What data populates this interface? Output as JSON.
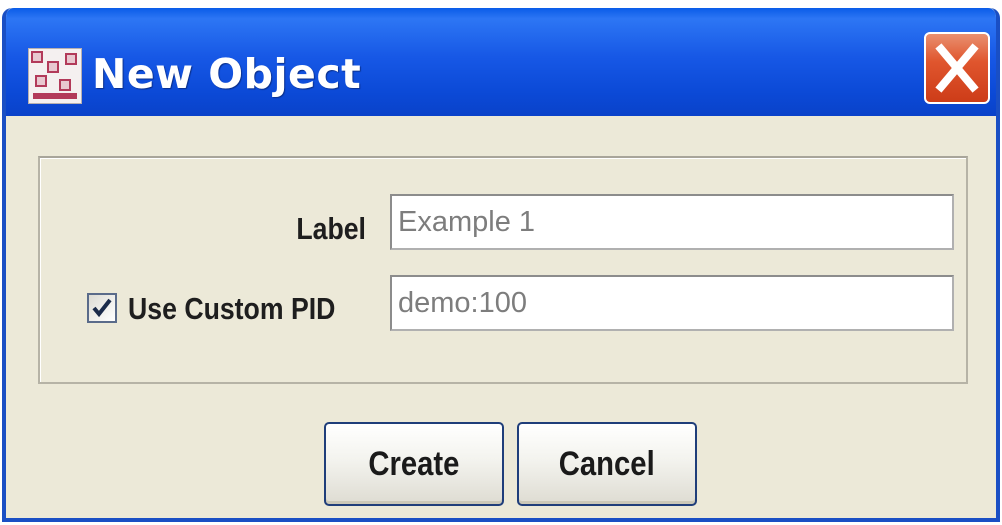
{
  "window": {
    "title": "New Object",
    "icon": "app-grid-icon",
    "title_bar_color": "#1758e6",
    "close_button_color": "#e0562e"
  },
  "form": {
    "label_field": {
      "label": "Label",
      "value": "Example 1"
    },
    "pid_field": {
      "label": "Use Custom PID",
      "checked": true,
      "value": "demo:100"
    }
  },
  "buttons": {
    "create_label": "Create",
    "cancel_label": "Cancel"
  }
}
